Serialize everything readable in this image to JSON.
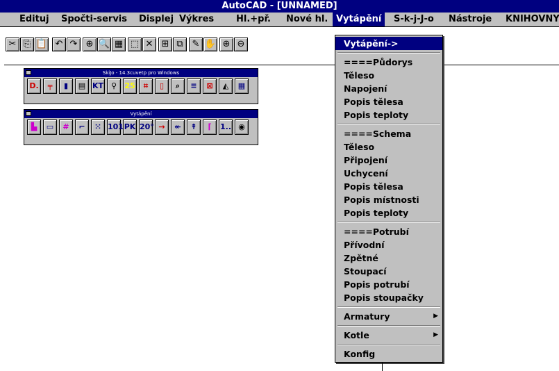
{
  "window": {
    "title": "AutoCAD - [UNNAMED]"
  },
  "menubar": {
    "items": [
      {
        "label": "Edituj"
      },
      {
        "label": "Spočti-servis"
      },
      {
        "label": "Displej"
      },
      {
        "label": "Výkres"
      },
      {
        "label": "Hl.+př."
      },
      {
        "label": "Nové hl."
      },
      {
        "label": "Vytápění"
      },
      {
        "label": "S-k-j-J-o"
      },
      {
        "label": "Nástroje"
      },
      {
        "label": "KNIHOVNY"
      }
    ]
  },
  "toolbar": {
    "buttons": [
      {
        "icon": "cut-icon",
        "glyph": "✂"
      },
      {
        "icon": "copy-icon",
        "glyph": "⎘"
      },
      {
        "icon": "paste-icon",
        "glyph": "📋"
      },
      {
        "icon": "undo-icon",
        "glyph": "↶"
      },
      {
        "icon": "redo-icon",
        "glyph": "↷"
      },
      {
        "icon": "snap-icon",
        "glyph": "⊕"
      },
      {
        "icon": "zoom-window-icon",
        "glyph": "🔍"
      },
      {
        "icon": "calculator-icon",
        "glyph": "▦"
      },
      {
        "icon": "select-window-icon",
        "glyph": "⬚"
      },
      {
        "icon": "osnap-icon",
        "glyph": "✕"
      },
      {
        "icon": "layers-icon",
        "glyph": "⊞"
      },
      {
        "icon": "properties-icon",
        "glyph": "⧉"
      },
      {
        "icon": "pencil-icon",
        "glyph": "✎"
      },
      {
        "icon": "pan-icon",
        "glyph": "✋"
      },
      {
        "icon": "zoom-in-icon",
        "glyph": "⊕"
      },
      {
        "icon": "zoom-out-icon",
        "glyph": "⊖"
      }
    ]
  },
  "palette1": {
    "title": "SkiJo - 14.3cuvetp pro Windows",
    "buttons": [
      {
        "icon": "d-icon",
        "label": "D.",
        "color": "#cc0000"
      },
      {
        "icon": "rail-icon",
        "label": "╤",
        "color": "#cc0000"
      },
      {
        "icon": "block-icon",
        "label": "▮",
        "color": "#000080"
      },
      {
        "icon": "list-icon",
        "label": "▤",
        "color": "#000000"
      },
      {
        "icon": "kt-icon",
        "label": "KT",
        "color": "#000080"
      },
      {
        "icon": "magnify-icon",
        "label": "⚲",
        "color": "#000000"
      },
      {
        "icon": "yellow-box-icon",
        "label": "25",
        "color": "#ffff00"
      },
      {
        "icon": "hatch-icon",
        "label": "⌗",
        "color": "#cc0000"
      },
      {
        "icon": "book-icon",
        "label": "▯",
        "color": "#cc0000"
      },
      {
        "icon": "search-icon",
        "label": "⌕",
        "color": "#000000"
      },
      {
        "icon": "stack-icon",
        "label": "≡",
        "color": "#000080"
      },
      {
        "icon": "grid-icon",
        "label": "⊠",
        "color": "#cc0000"
      },
      {
        "icon": "arch-icon",
        "label": "◭",
        "color": "#000000"
      },
      {
        "icon": "panel-icon",
        "label": "▦",
        "color": "#000080"
      }
    ]
  },
  "palette2": {
    "title": "Vytápění",
    "buttons": [
      {
        "icon": "radiator-icon",
        "label": "▙",
        "color": "#cc00cc"
      },
      {
        "icon": "connector-icon",
        "label": "▭",
        "color": "#000080"
      },
      {
        "icon": "grid-radiator-icon",
        "label": "#",
        "color": "#cc00cc"
      },
      {
        "icon": "pipe-icon",
        "label": "⌐",
        "color": "#000080"
      },
      {
        "icon": "dots-icon",
        "label": "⁙",
        "color": "#000080"
      },
      {
        "icon": "number-101-icon",
        "label": "101",
        "color": "#000080"
      },
      {
        "icon": "label-pk-icon",
        "label": "PK",
        "color": "#000080"
      },
      {
        "icon": "temperature-icon",
        "label": "20°",
        "color": "#000080"
      },
      {
        "icon": "arrow-right-icon",
        "label": "→",
        "color": "#cc0000"
      },
      {
        "icon": "arrow-left-icon",
        "label": "↞",
        "color": "#000080"
      },
      {
        "icon": "arrow-up-icon",
        "label": "↟",
        "color": "#000080"
      },
      {
        "icon": "riser-icon",
        "label": "⌈",
        "color": "#cc00cc"
      },
      {
        "icon": "number-1-icon",
        "label": "1..",
        "color": "#000080"
      },
      {
        "icon": "play-icon",
        "label": "◉",
        "color": "#000000"
      }
    ]
  },
  "dropdown": {
    "items": [
      {
        "label": "Vytápění->",
        "selected": true,
        "submenu": false,
        "sep_after": true
      },
      {
        "label": "====Půdorys",
        "selected": false,
        "submenu": false,
        "sep_after": false
      },
      {
        "label": "Těleso",
        "selected": false,
        "submenu": false,
        "sep_after": false
      },
      {
        "label": "Napojení",
        "selected": false,
        "submenu": false,
        "sep_after": false
      },
      {
        "label": "Popis tělesa",
        "selected": false,
        "submenu": false,
        "sep_after": false
      },
      {
        "label": "Popis teploty",
        "selected": false,
        "submenu": false,
        "sep_after": true
      },
      {
        "label": "====Schema",
        "selected": false,
        "submenu": false,
        "sep_after": false
      },
      {
        "label": "Těleso",
        "selected": false,
        "submenu": false,
        "sep_after": false
      },
      {
        "label": "Připojení",
        "selected": false,
        "submenu": false,
        "sep_after": false
      },
      {
        "label": "Uchycení",
        "selected": false,
        "submenu": false,
        "sep_after": false
      },
      {
        "label": "Popis tělesa",
        "selected": false,
        "submenu": false,
        "sep_after": false
      },
      {
        "label": "Popis místnosti",
        "selected": false,
        "submenu": false,
        "sep_after": false
      },
      {
        "label": "Popis teploty",
        "selected": false,
        "submenu": false,
        "sep_after": true
      },
      {
        "label": "====Potrubí",
        "selected": false,
        "submenu": false,
        "sep_after": false
      },
      {
        "label": "Přívodní",
        "selected": false,
        "submenu": false,
        "sep_after": false
      },
      {
        "label": "Zpětné",
        "selected": false,
        "submenu": false,
        "sep_after": false
      },
      {
        "label": "Stoupací",
        "selected": false,
        "submenu": false,
        "sep_after": false
      },
      {
        "label": "Popis potrubí",
        "selected": false,
        "submenu": false,
        "sep_after": false
      },
      {
        "label": "Popis stoupačky",
        "selected": false,
        "submenu": false,
        "sep_after": true
      },
      {
        "label": "Armatury",
        "selected": false,
        "submenu": true,
        "sep_after": true
      },
      {
        "label": "Kotle",
        "selected": false,
        "submenu": true,
        "sep_after": true
      },
      {
        "label": "Konfig",
        "selected": false,
        "submenu": false,
        "sep_after": false
      }
    ]
  },
  "colors": {
    "title_bg": "#000080",
    "face": "#c0c0c0",
    "highlight": "#000080"
  }
}
